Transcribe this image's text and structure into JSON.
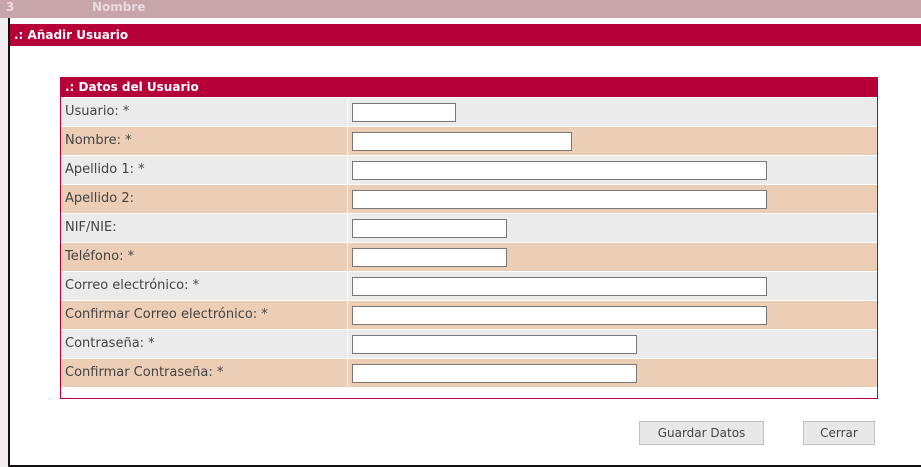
{
  "background": {
    "header_num": "3",
    "header_col": "Nombre"
  },
  "dialog": {
    "title": ".: Añadir Usuario"
  },
  "panel": {
    "title": ".: Datos del Usuario",
    "fields": [
      {
        "label": "Usuario: *",
        "value": ""
      },
      {
        "label": "Nombre: *",
        "value": ""
      },
      {
        "label": "Apellido 1: *",
        "value": ""
      },
      {
        "label": "Apellido 2:",
        "value": ""
      },
      {
        "label": "NIF/NIE:",
        "value": ""
      },
      {
        "label": "Teléfono: *",
        "value": ""
      },
      {
        "label": "Correo electrónico: *",
        "value": ""
      },
      {
        "label": "Confirmar Correo electrónico: *",
        "value": ""
      },
      {
        "label": "Contraseña: *",
        "value": ""
      },
      {
        "label": "Confirmar Contraseña: *",
        "value": ""
      }
    ]
  },
  "buttons": {
    "save": "Guardar Datos",
    "close": "Cerrar"
  },
  "colors": {
    "accent": "#b5003a",
    "row_odd": "#ebebeb",
    "row_even": "#eccdb5"
  }
}
